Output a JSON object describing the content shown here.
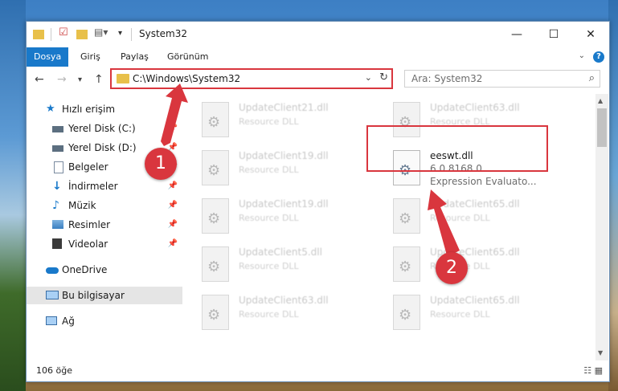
{
  "window": {
    "title": "System32",
    "controls": {
      "minimize": "—",
      "maximize": "☐",
      "close": "✕"
    }
  },
  "ribbon": {
    "tabs": [
      "Dosya",
      "Giriş",
      "Paylaş",
      "Görünüm"
    ],
    "active_tab": "Dosya"
  },
  "nav": {
    "address": "C:\\Windows\\System32",
    "search_placeholder": "Ara: System32"
  },
  "sidebar": {
    "items": [
      {
        "label": "Hızlı erişim",
        "icon": "star-icon"
      },
      {
        "label": "Yerel Disk (C:)",
        "icon": "drive-icon",
        "pinned": true
      },
      {
        "label": "Yerel Disk (D:)",
        "icon": "drive-icon",
        "pinned": true
      },
      {
        "label": "Belgeler",
        "icon": "document-icon",
        "pinned": true
      },
      {
        "label": "İndirmeler",
        "icon": "download-icon",
        "pinned": true
      },
      {
        "label": "Müzik",
        "icon": "music-icon",
        "pinned": true
      },
      {
        "label": "Resimler",
        "icon": "pictures-icon",
        "pinned": true
      },
      {
        "label": "Videolar",
        "icon": "video-icon",
        "pinned": true
      },
      {
        "label": "OneDrive",
        "icon": "cloud-icon"
      },
      {
        "label": "Bu bilgisayar",
        "icon": "computer-icon",
        "selected": true
      },
      {
        "label": "Ağ",
        "icon": "network-icon"
      }
    ]
  },
  "files": [
    {
      "name": "UpdateClient21.dll",
      "type": "Resource DLL"
    },
    {
      "name": "UpdateClient63.dll",
      "type": "Resource DLL"
    },
    {
      "name": "UpdateClient19.dll",
      "type": "Resource DLL"
    },
    {
      "name": "eeswt.dll",
      "version": "6.0.8168.0",
      "description": "Expression Evaluato...",
      "highlighted": true
    },
    {
      "name": "UpdateClient19.dll",
      "type": "Resource DLL"
    },
    {
      "name": "UpdateClient65.dll",
      "type": "Resource DLL"
    },
    {
      "name": "UpdateClient5.dll",
      "type": "Resource DLL"
    },
    {
      "name": "UpdateClient65.dll",
      "type": "Resource DLL"
    },
    {
      "name": "UpdateClient63.dll",
      "type": "Resource DLL"
    },
    {
      "name": "UpdateClient65.dll",
      "type": "Resource DLL"
    }
  ],
  "status": {
    "item_count": "106 öğe"
  },
  "markers": [
    "1",
    "2"
  ],
  "colors": {
    "accent": "#1979ca",
    "highlight": "#d9363e"
  }
}
